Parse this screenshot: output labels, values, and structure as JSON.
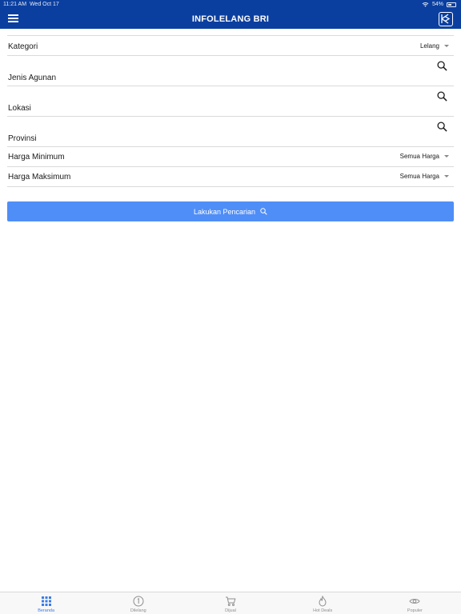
{
  "status": {
    "time": "11:21 AM",
    "date": "Wed Oct 17",
    "battery": "54%"
  },
  "header": {
    "title": "INFOLELANG BRI"
  },
  "form": {
    "kategori": {
      "label": "Kategori",
      "value": "Lelang"
    },
    "jenis_agunan": {
      "label": "Jenis Agunan"
    },
    "lokasi": {
      "label": "Lokasi"
    },
    "provinsi": {
      "label": "Provinsi"
    },
    "harga_minimum": {
      "label": "Harga Minimum",
      "value": "Semua Harga"
    },
    "harga_maksimum": {
      "label": "Harga Maksimum",
      "value": "Semua Harga"
    }
  },
  "search_button": {
    "label": "Lakukan Pencarian"
  },
  "tabs": [
    {
      "label": "Beranda",
      "icon": "grid-icon",
      "active": true
    },
    {
      "label": "Dilelang",
      "icon": "auction-icon"
    },
    {
      "label": "Dijual",
      "icon": "cart-icon"
    },
    {
      "label": "Hot Deals",
      "icon": "fire-icon"
    },
    {
      "label": "Populer",
      "icon": "eye-icon"
    }
  ],
  "colors": {
    "header": "#0b3f9f",
    "button": "#4f8ef7",
    "active_tab": "#3b7be6"
  }
}
